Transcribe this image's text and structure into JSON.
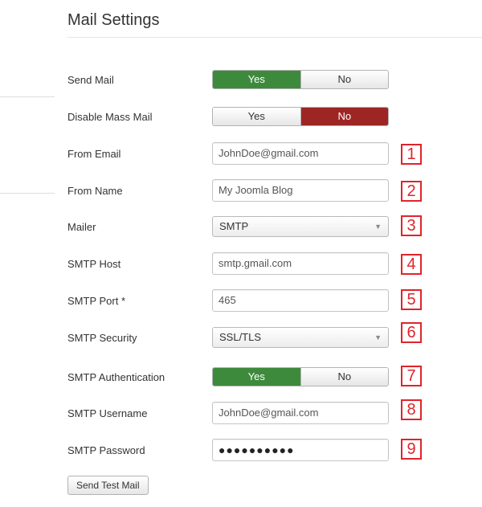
{
  "page": {
    "title": "Mail Settings"
  },
  "fields": {
    "send_mail": {
      "label": "Send Mail",
      "yes": "Yes",
      "no": "No",
      "selected": "Yes"
    },
    "disable_mass_mail": {
      "label": "Disable Mass Mail",
      "yes": "Yes",
      "no": "No",
      "selected": "No"
    },
    "from_email": {
      "label": "From Email",
      "value": "JohnDoe@gmail.com",
      "marker": "1"
    },
    "from_name": {
      "label": "From Name",
      "value": "My Joomla Blog",
      "marker": "2"
    },
    "mailer": {
      "label": "Mailer",
      "value": "SMTP",
      "marker": "3"
    },
    "smtp_host": {
      "label": "SMTP Host",
      "value": "smtp.gmail.com",
      "marker": "4"
    },
    "smtp_port": {
      "label": "SMTP Port *",
      "value": "465",
      "marker": "5"
    },
    "smtp_security": {
      "label": "SMTP Security",
      "value": "SSL/TLS",
      "marker": "6"
    },
    "smtp_auth": {
      "label": "SMTP Authentication",
      "yes": "Yes",
      "no": "No",
      "selected": "Yes",
      "marker": "7"
    },
    "smtp_username": {
      "label": "SMTP Username",
      "value": "JohnDoe@gmail.com",
      "marker": "8"
    },
    "smtp_password": {
      "label": "SMTP Password",
      "value": "●●●●●●●●●●",
      "marker": "9"
    }
  },
  "actions": {
    "send_test_mail": "Send Test Mail"
  },
  "icons": {
    "select_caret": "caret-down-icon"
  },
  "colors": {
    "yes_active": "#3d8a3d",
    "no_active": "#9d2624",
    "marker": "#e0242b"
  }
}
